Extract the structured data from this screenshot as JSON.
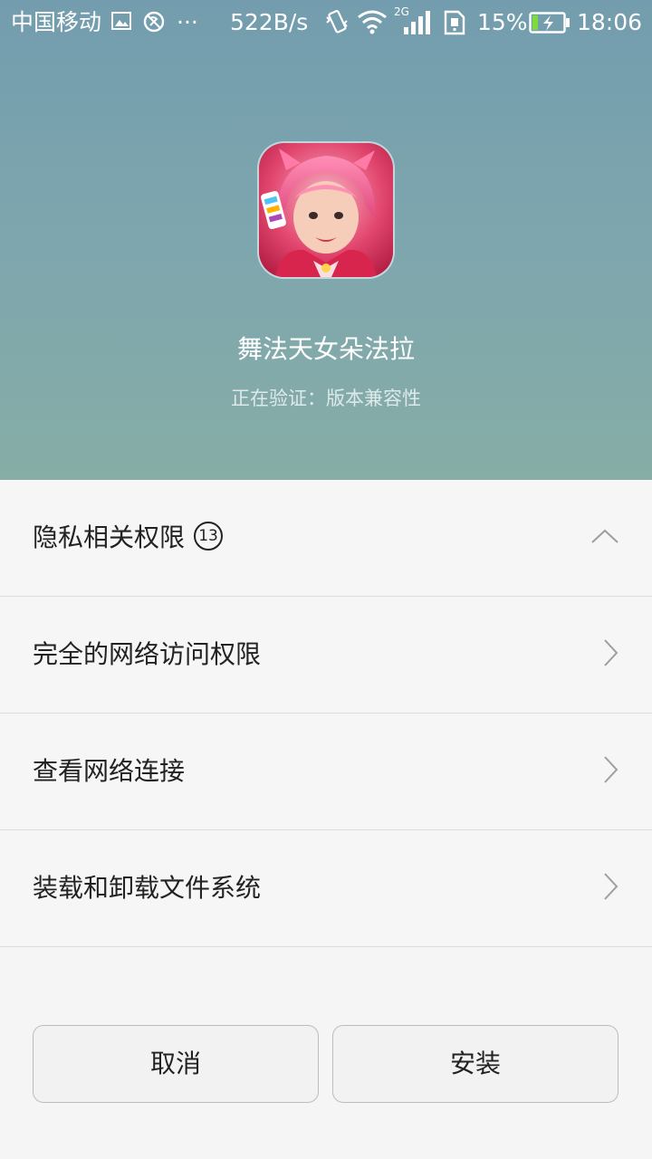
{
  "status_bar": {
    "carrier": "中国移动",
    "more": "···",
    "network_speed": "522B/s",
    "network_type": "2G",
    "battery_percent": "15%",
    "time": "18:06",
    "icons": [
      "image-icon",
      "no-disturb-icon",
      "vibrate-icon",
      "wifi-icon",
      "signal-icon",
      "sim-icon",
      "battery-charging-icon"
    ]
  },
  "app": {
    "name": "舞法天女朵法拉",
    "status": "正在验证：版本兼容性"
  },
  "permissions": {
    "header": {
      "label": "隐私相关权限",
      "count": "13"
    },
    "items": [
      {
        "label": "完全的网络访问权限"
      },
      {
        "label": "查看网络连接"
      },
      {
        "label": "装载和卸载文件系统"
      }
    ]
  },
  "buttons": {
    "cancel": "取消",
    "install": "安装"
  },
  "colors": {
    "header_top": "#739dae",
    "header_bottom": "#86ada6",
    "list_bg": "#f6f6f6"
  }
}
